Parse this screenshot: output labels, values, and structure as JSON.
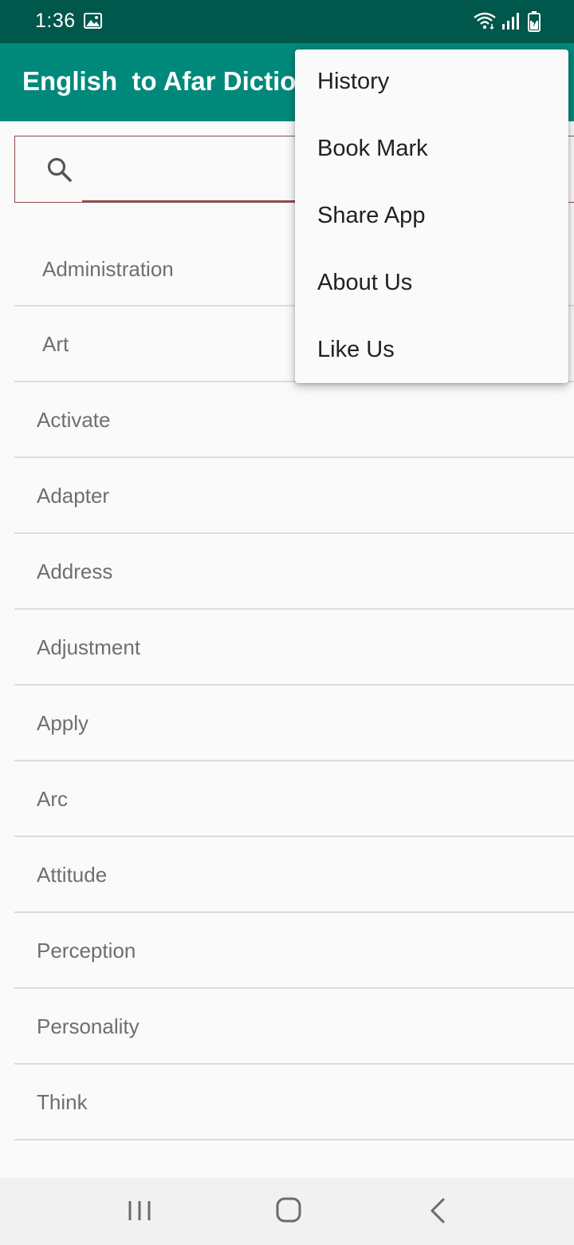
{
  "status_bar": {
    "time": "1:36",
    "icons": [
      "image-icon",
      "wifi-icon",
      "signal-icon",
      "battery-charging-icon"
    ],
    "background": "#00574b"
  },
  "app_bar": {
    "title": "English  to Afar Diction",
    "background": "#00897b"
  },
  "search": {
    "value": "",
    "placeholder": "",
    "icon": "search-icon",
    "border_color": "#8d4a4a"
  },
  "words": [
    "Administration",
    "Art",
    "Activate",
    "Adapter",
    "Address",
    "Adjustment",
    "Apply",
    "Arc",
    "Attitude",
    "Perception",
    "Personality",
    "Think"
  ],
  "overflow_menu": {
    "items": [
      "History",
      "Book Mark",
      "Share App",
      "About Us",
      "Like Us"
    ]
  },
  "nav_bar": {
    "icons": [
      "recent-apps-icon",
      "home-icon",
      "back-icon"
    ]
  }
}
